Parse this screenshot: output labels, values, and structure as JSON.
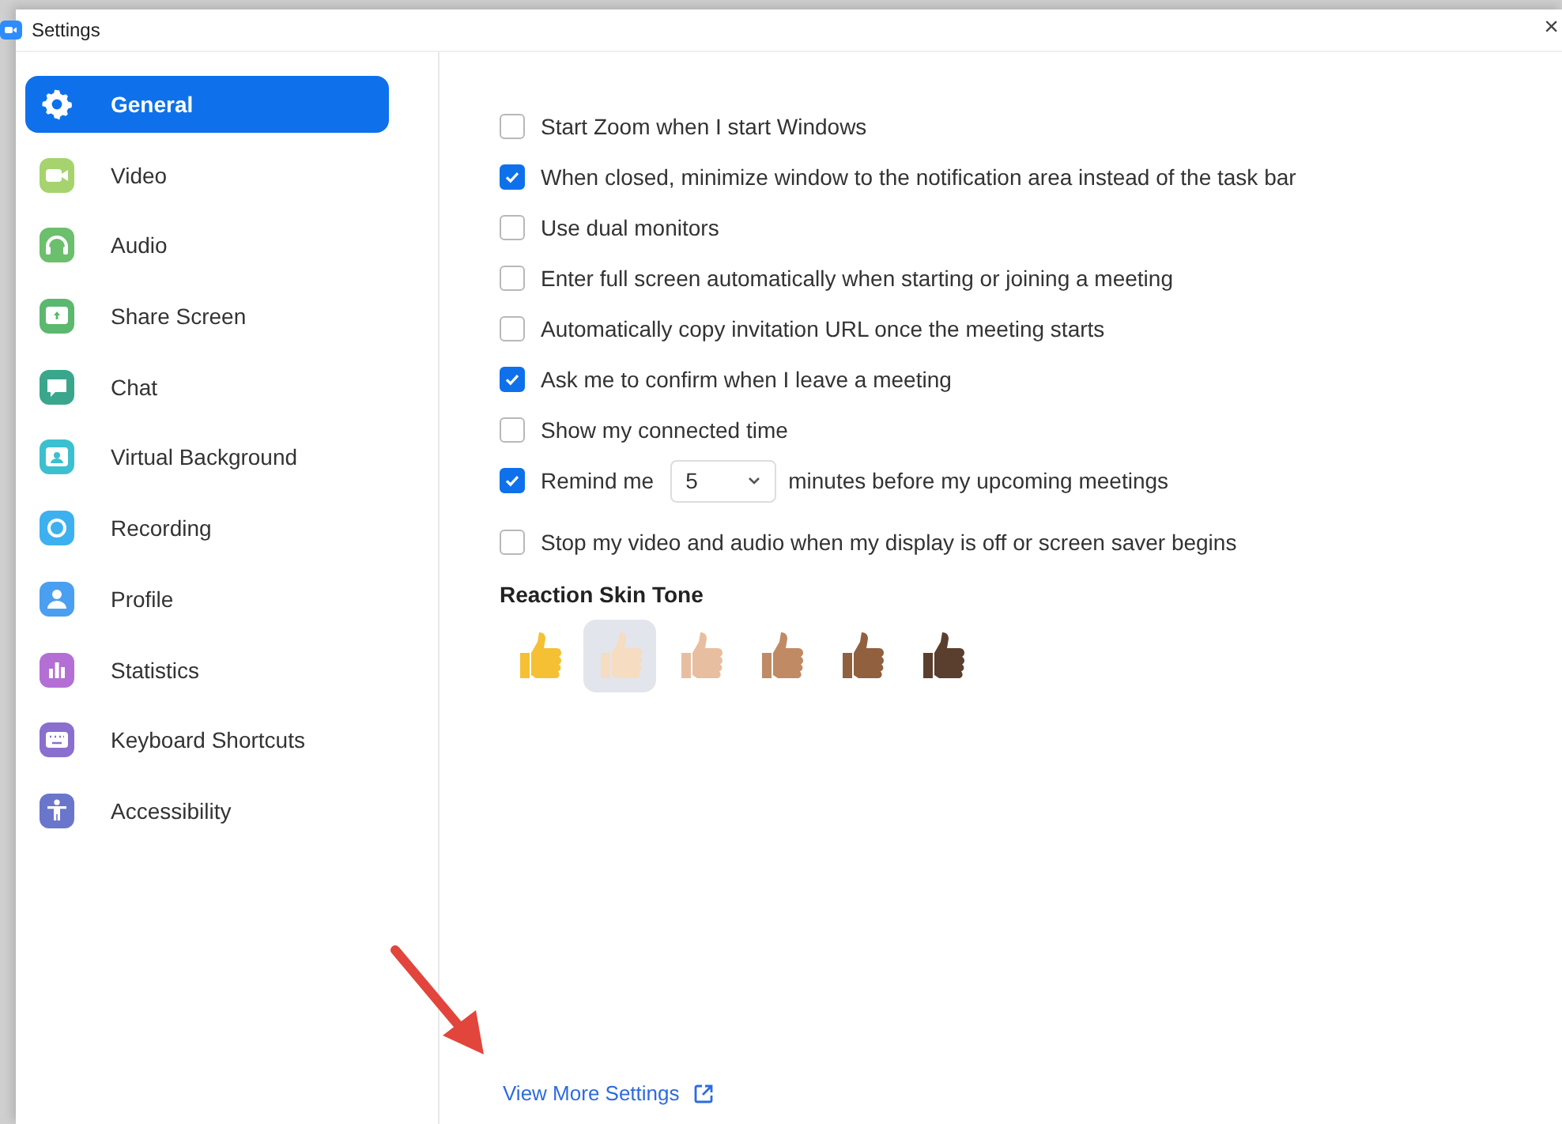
{
  "window": {
    "title": "Settings",
    "close_label": "×"
  },
  "sidebar": {
    "items": [
      {
        "label": "General",
        "selected": true,
        "color": "#ffffff"
      },
      {
        "label": "Video",
        "selected": false,
        "color": "#a6d36e"
      },
      {
        "label": "Audio",
        "selected": false,
        "color": "#6cbf6c"
      },
      {
        "label": "Share Screen",
        "selected": false,
        "color": "#5bb86e"
      },
      {
        "label": "Chat",
        "selected": false,
        "color": "#3aa78d"
      },
      {
        "label": "Virtual Background",
        "selected": false,
        "color": "#3cc0d0"
      },
      {
        "label": "Recording",
        "selected": false,
        "color": "#3db1ef"
      },
      {
        "label": "Profile",
        "selected": false,
        "color": "#4b9ff0"
      },
      {
        "label": "Statistics",
        "selected": false,
        "color": "#b46fd5"
      },
      {
        "label": "Keyboard Shortcuts",
        "selected": false,
        "color": "#8a6fcf"
      },
      {
        "label": "Accessibility",
        "selected": false,
        "color": "#6a76cb"
      }
    ]
  },
  "options": [
    {
      "kind": "checkbox",
      "label": "Start Zoom when I start Windows",
      "checked": false
    },
    {
      "kind": "checkbox",
      "label": "When closed, minimize window to the notification area instead of the task bar",
      "checked": true
    },
    {
      "kind": "checkbox",
      "label": "Use dual monitors",
      "checked": false
    },
    {
      "kind": "checkbox",
      "label": "Enter full screen automatically when starting or joining a meeting",
      "checked": false
    },
    {
      "kind": "checkbox",
      "label": "Automatically copy invitation URL once the meeting starts",
      "checked": false
    },
    {
      "kind": "checkbox",
      "label": "Ask me to confirm when I leave a meeting",
      "checked": true
    },
    {
      "kind": "checkbox",
      "label": "Show my connected time",
      "checked": false
    },
    {
      "kind": "reminder",
      "label": "Remind me",
      "checked": true,
      "value": "5",
      "suffix": "minutes before my upcoming meetings"
    },
    {
      "kind": "checkbox",
      "label": "Stop my video and audio when my display is off or screen saver begins",
      "checked": false
    }
  ],
  "skin_tone": {
    "heading": "Reaction Skin Tone",
    "tones": [
      {
        "color": "#f5c033",
        "selected": false
      },
      {
        "color": "#f6dcc0",
        "selected": true
      },
      {
        "color": "#e8bea0",
        "selected": false
      },
      {
        "color": "#bf8a64",
        "selected": false
      },
      {
        "color": "#91603f",
        "selected": false
      },
      {
        "color": "#5a3e2e",
        "selected": false
      }
    ]
  },
  "link": {
    "label": "View More Settings"
  },
  "overlay": {
    "kind": "arrow"
  }
}
